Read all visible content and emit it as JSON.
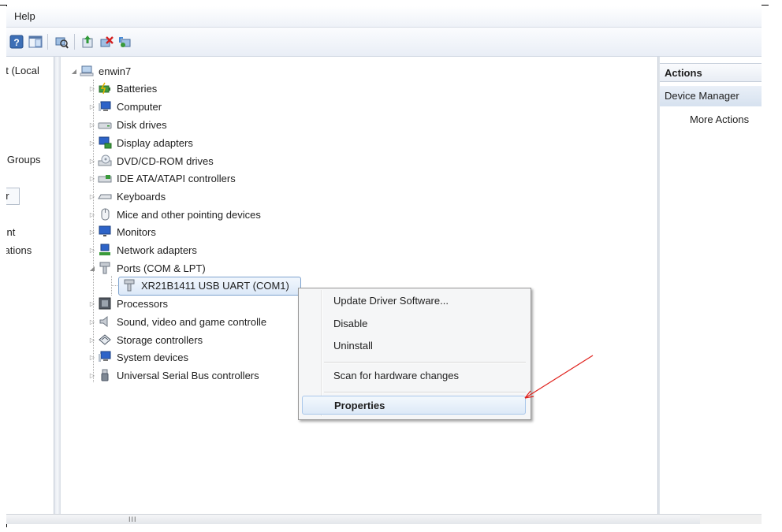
{
  "menu": {
    "help_label": "Help"
  },
  "toolbar": {
    "icons": [
      "help-icon",
      "show-hide-pane-icon",
      "scan-hardware-icon",
      "update-driver-icon",
      "uninstall-icon",
      "enable-device-icon"
    ]
  },
  "left_pane": {
    "items": [
      "nt (Local",
      "r",
      "d Groups",
      "er",
      "nent",
      "cations"
    ]
  },
  "tree": {
    "root": "enwin7",
    "categories": [
      "Batteries",
      "Computer",
      "Disk drives",
      "Display adapters",
      "DVD/CD-ROM drives",
      "IDE ATA/ATAPI controllers",
      "Keyboards",
      "Mice and other pointing devices",
      "Monitors",
      "Network adapters",
      "Ports (COM & LPT)",
      "Processors",
      "Sound, video and game controlle",
      "Storage controllers",
      "System devices",
      "Universal Serial Bus controllers"
    ],
    "ports_child": "XR21B1411 USB UART (COM1)"
  },
  "actions": {
    "title": "Actions",
    "section": "Device Manager",
    "more": "More Actions"
  },
  "context_menu": {
    "items": [
      "Update Driver Software...",
      "Disable",
      "Uninstall",
      "Scan for hardware changes",
      "Properties"
    ]
  },
  "scrollbar": {
    "grip": "III"
  },
  "colors": {
    "selection_border": "#7da2ce",
    "arrow": "#e0201b",
    "pane_header": "#e8edf4"
  }
}
